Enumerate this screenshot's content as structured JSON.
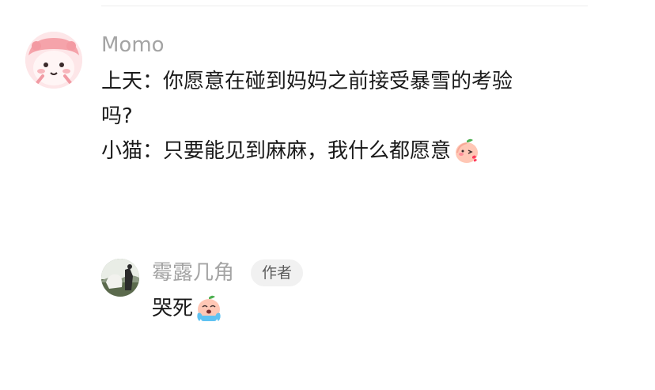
{
  "comment": {
    "username": "Momo",
    "lines": [
      "上天：你愿意在碰到妈妈之前接受暴雪的考验",
      "吗?",
      "小猫：只要能见到麻麻，我什么都愿意"
    ],
    "emoji": "peach-kiss-icon"
  },
  "reply": {
    "username": "霉露几角",
    "badge": "作者",
    "text": "哭死",
    "emoji": "peach-crying-icon"
  },
  "colors": {
    "username": "#a4a4a4",
    "text": "#1a1a1a",
    "badge_bg": "#f1f1f1",
    "divider": "#ececec"
  }
}
